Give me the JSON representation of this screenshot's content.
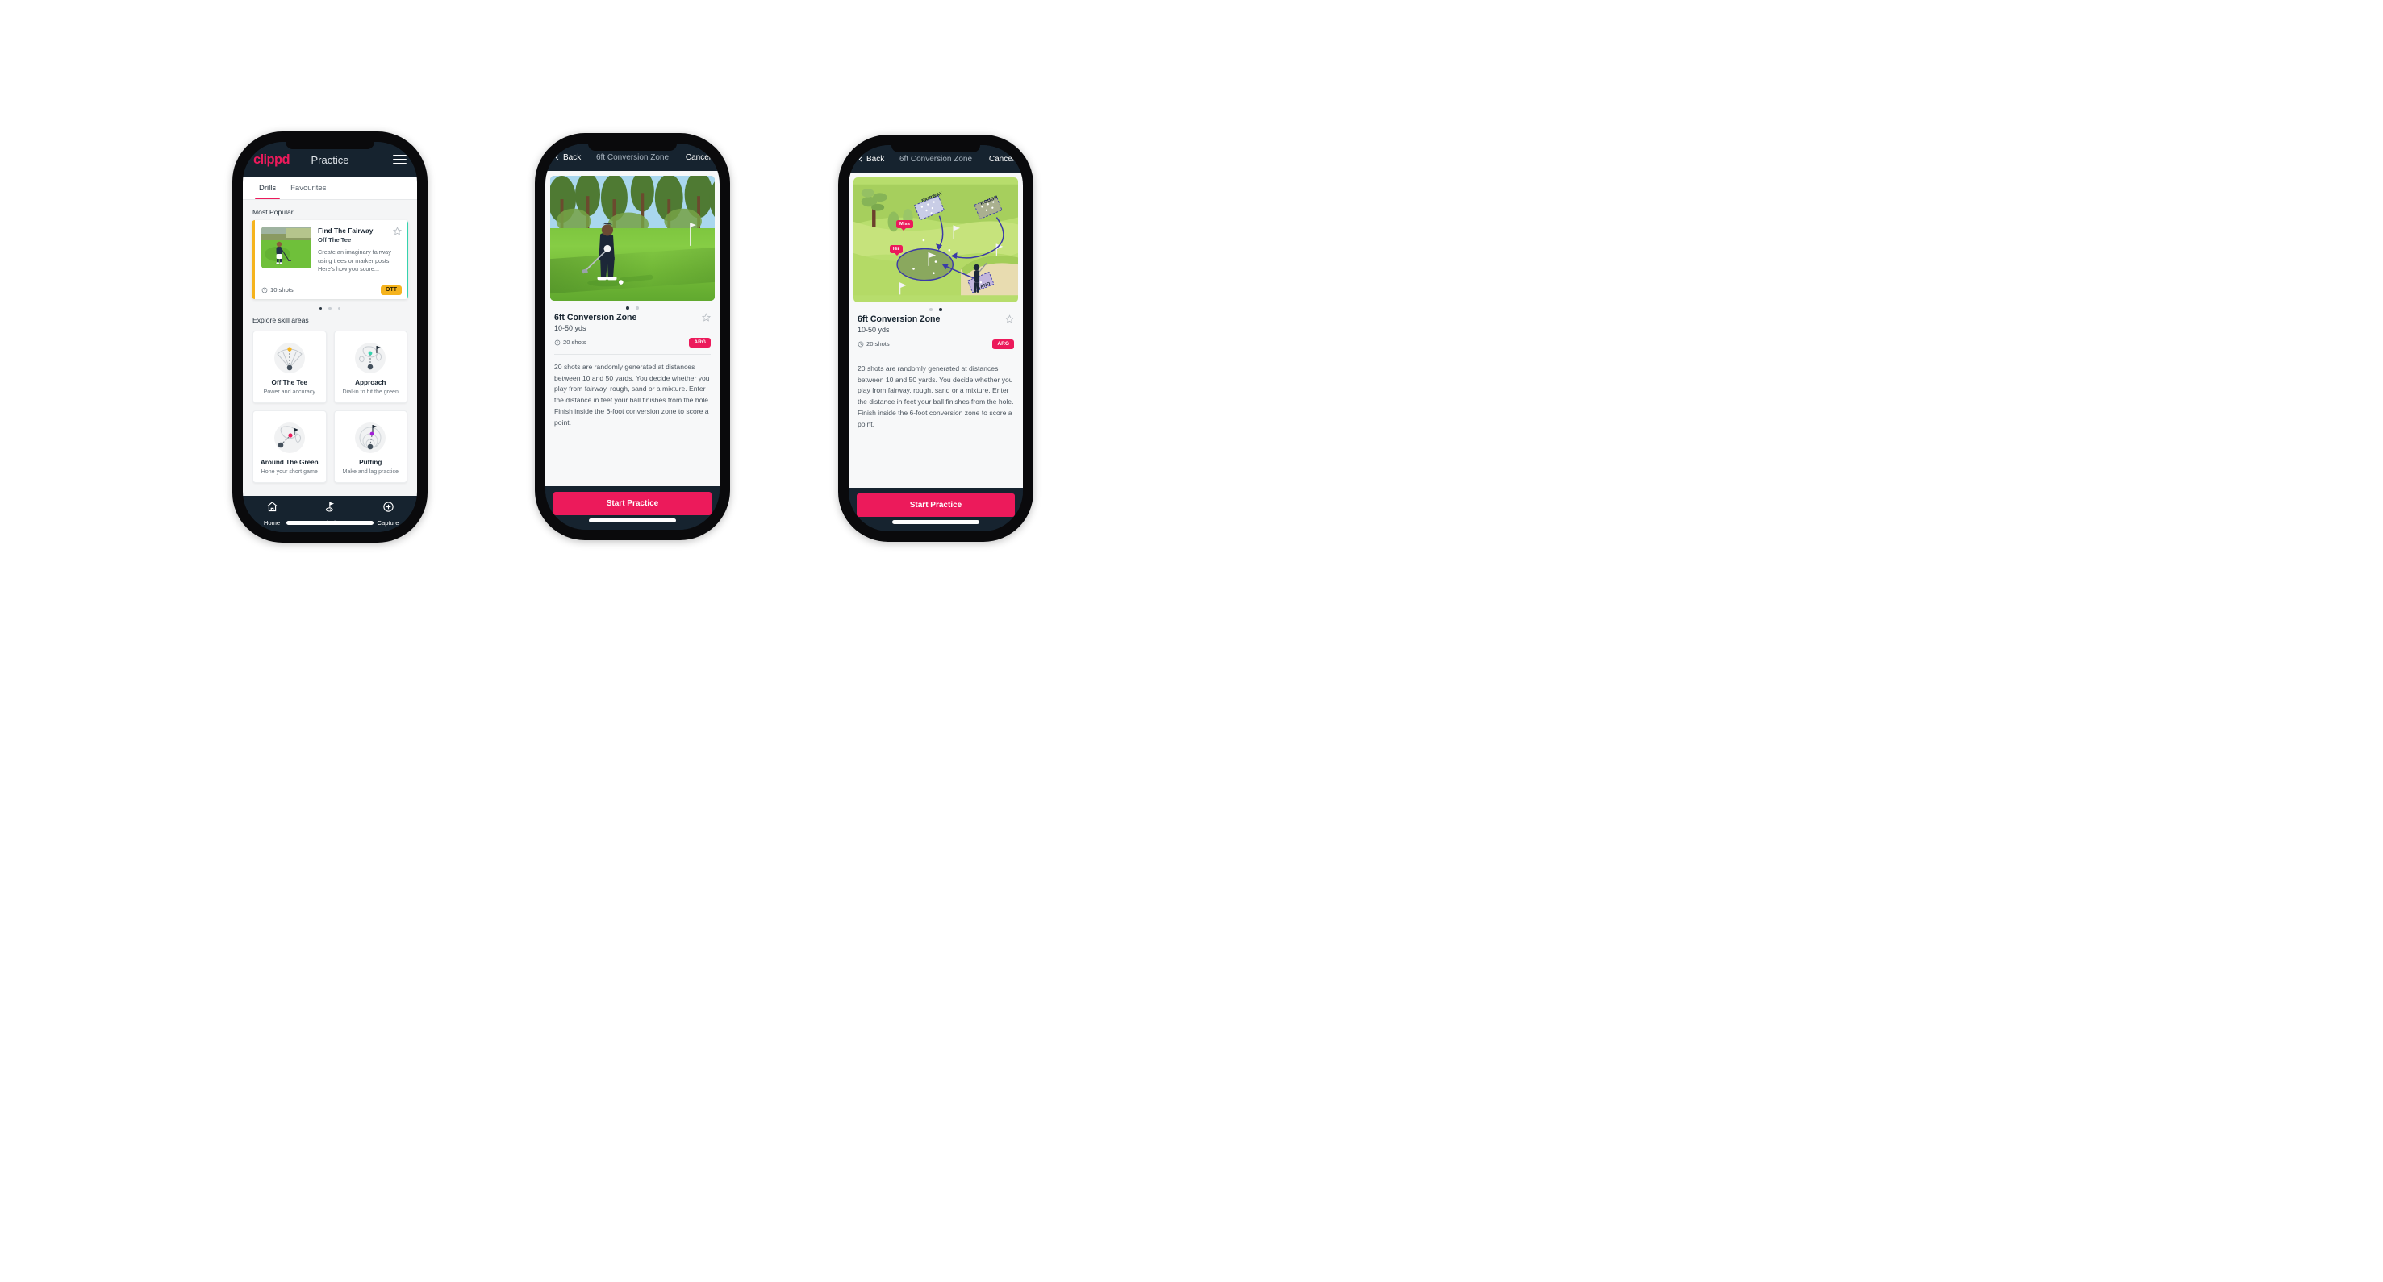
{
  "phone1": {
    "appbar": {
      "logo": "clippd",
      "title": "Practice",
      "menu_icon": "hamburger-menu-icon"
    },
    "tabs": [
      {
        "label": "Drills",
        "active": true
      },
      {
        "label": "Favourites",
        "active": false
      }
    ],
    "most_popular": {
      "section_label": "Most Popular",
      "card": {
        "title": "Find The Fairway",
        "subtitle": "Off The Tee",
        "description": "Create an imaginary fairway using trees or marker posts. Here's how you score...",
        "shots": "10 shots",
        "chip": "OTT",
        "chip_color": "#f5b31d",
        "accent_color": "#f5b31d",
        "favourite_icon": "star-outline-icon"
      },
      "carousel_dots": 3,
      "carousel_active": 0
    },
    "explore": {
      "section_label": "Explore skill areas",
      "skills": [
        {
          "name": "Off The Tee",
          "sub": "Power and accuracy",
          "icon": "tee-dispersion-icon",
          "dot_color": "#f5b31d"
        },
        {
          "name": "Approach",
          "sub": "Dial-in to hit the green",
          "icon": "approach-green-icon",
          "dot_color": "#35d3ae"
        },
        {
          "name": "Around The Green",
          "sub": "Hone your short game",
          "icon": "around-green-icon",
          "dot_color": "#ec1a5b"
        },
        {
          "name": "Putting",
          "sub": "Make and lag practice",
          "icon": "putting-rings-icon",
          "dot_color": "#a21fd6"
        }
      ]
    },
    "tabbar": [
      {
        "label": "Home",
        "icon": "home-icon",
        "active": false
      },
      {
        "label": "Activities",
        "icon": "golf-flag-icon",
        "active": true
      },
      {
        "label": "Capture",
        "icon": "plus-circle-icon",
        "active": false
      }
    ]
  },
  "detail": {
    "nav": {
      "back": "Back",
      "title": "6ft Conversion Zone",
      "cancel": "Cancel",
      "back_icon": "chevron-left-icon"
    },
    "title": "6ft Conversion Zone",
    "distance": "10-50 yds",
    "shots": "20 shots",
    "chip": "ARG",
    "chip_color": "#ec1a5b",
    "favourite_icon": "star-outline-icon",
    "description": "20 shots are randomly generated at distances between 10 and 50 yards. You decide whether you play from fairway, rough, sand or a mixture. Enter the distance in feet your ball finishes from the hole. Finish inside the 6-foot conversion zone to score a point.",
    "cta": "Start Practice",
    "carousel_dots": 2,
    "phone2_active_dot": 0,
    "phone3_active_dot": 1,
    "illustration": {
      "labels": [
        "FAIRWAY",
        "ROUGH",
        "SAND"
      ],
      "markers": [
        "Miss",
        "Hit"
      ]
    }
  },
  "colors": {
    "brand_pink": "#ec1a5b",
    "navy": "#16232f",
    "amber": "#f5b31d",
    "teal": "#35d3ae",
    "page_bg": "#f4f5f6"
  }
}
